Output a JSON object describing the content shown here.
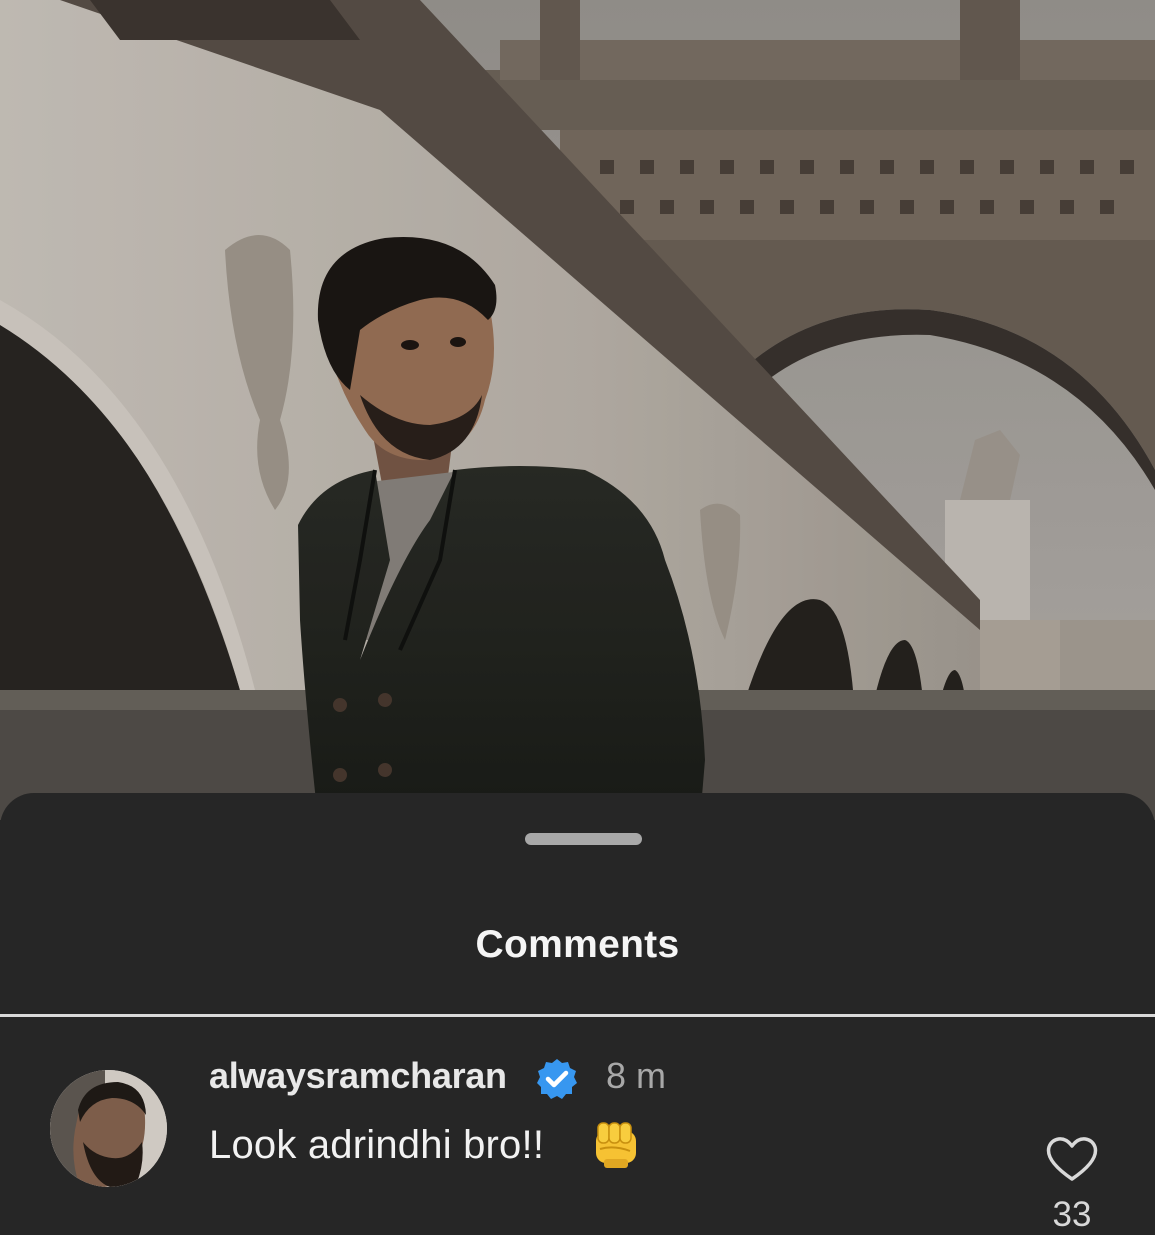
{
  "post": {
    "image_icon": "post-photo-man-in-dark-suit-under-eiffel-tower"
  },
  "sheet": {
    "title": "Comments"
  },
  "comment": {
    "username": "alwaysramcharan",
    "verified_icon": "verified-badge-icon",
    "time": "8 m",
    "text": "Look adrindhi bro!!",
    "emoji_icon": "oncoming-fist-emoji",
    "like_icon": "heart-outline-icon",
    "like_count": "33"
  },
  "colors": {
    "sheet_bg": "#262626",
    "verified_blue": "#3797f0",
    "text_primary": "#f2f2f2",
    "text_secondary": "#a8a8a8"
  }
}
